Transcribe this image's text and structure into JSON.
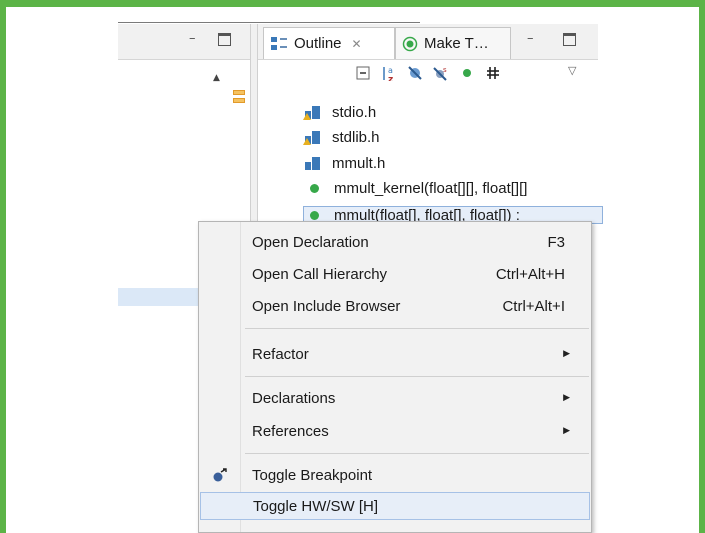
{
  "outline_view": {
    "tabs": [
      {
        "label": "Outline",
        "icon": "outline-view-icon",
        "close": "✕"
      },
      {
        "label": "Make T…",
        "icon": "make-target-icon"
      }
    ],
    "toolbar_icons": [
      "collapse-all-icon",
      "sort-az-icon",
      "hide-fields-icon",
      "hide-static-icon",
      "hide-non-public-icon",
      "hide-inactive-icon",
      "view-menu-icon"
    ],
    "tree_items": [
      {
        "label": "stdio.h",
        "icon": "include-warning-icon"
      },
      {
        "label": "stdlib.h",
        "icon": "include-warning-icon"
      },
      {
        "label": "mmult.h",
        "icon": "include-icon"
      },
      {
        "label": "mmult_kernel(float[][], float[][]",
        "icon": "function-icon"
      },
      {
        "label": "mmult(float[], float[], float[]) : ",
        "icon": "function-icon",
        "selected": true
      }
    ]
  },
  "context_menu": {
    "items": [
      {
        "label": "Open Declaration",
        "accel": "F3"
      },
      {
        "label": "Open Call Hierarchy",
        "accel": "Ctrl+Alt+H"
      },
      {
        "label": "Open Include Browser",
        "accel": "Ctrl+Alt+I"
      },
      {
        "label": "Refactor",
        "submenu": "▶"
      },
      {
        "label": "Declarations",
        "submenu": "▶"
      },
      {
        "label": "References",
        "submenu": "▶"
      },
      {
        "label": "Toggle Breakpoint",
        "icon": "breakpoint-icon"
      },
      {
        "label": "Toggle HW/SW [H]",
        "highlighted": true
      }
    ]
  },
  "colors": {
    "frame": "#5cb447",
    "selection": "#e7eef8",
    "function": "#37a84a",
    "include": "#3a78b8"
  }
}
